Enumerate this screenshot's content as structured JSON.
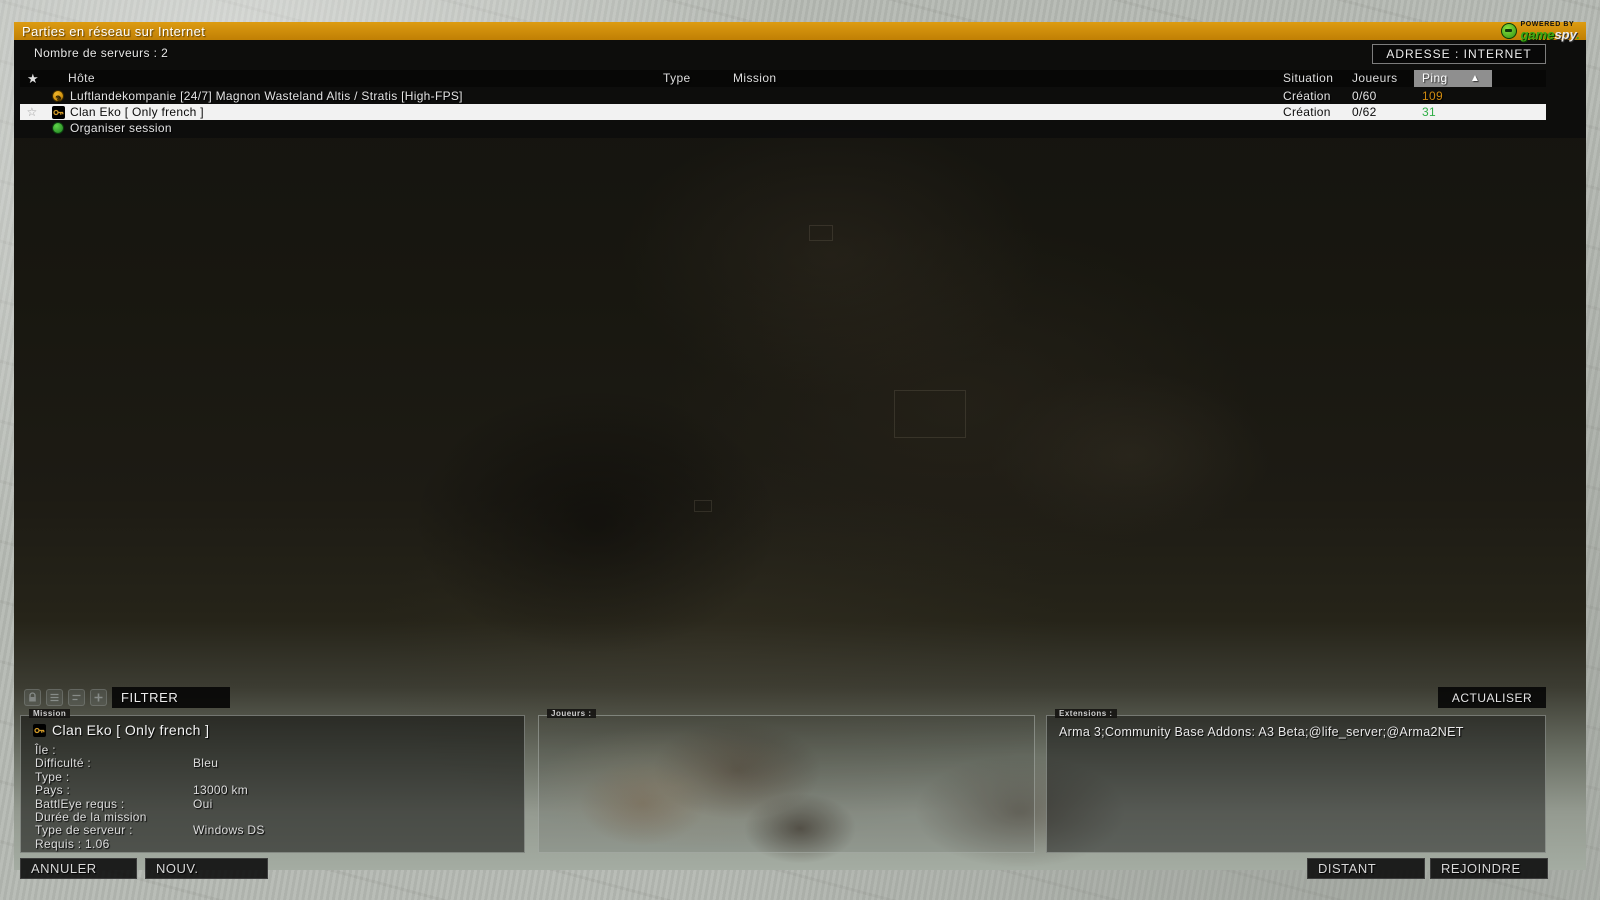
{
  "title_bar": {
    "title": "Parties en réseau sur Internet",
    "powered_by": "POWERED BY",
    "brand_game": "game",
    "brand_spy": "spy",
    "brand_dot": "."
  },
  "toolbar": {
    "server_count": "Nombre de serveurs : 2",
    "address_button": "ADRESSE : INTERNET"
  },
  "icons": {
    "favorite_filled": "★",
    "favorite_outline": "☆",
    "sort_asc": "▲",
    "question_glyph": "?"
  },
  "table": {
    "headers": {
      "host": "Hôte",
      "type": "Type",
      "mission": "Mission",
      "situation": "Situation",
      "players": "Joueurs",
      "ping": "Ping"
    },
    "rows": [
      {
        "icon": "question",
        "favorite": false,
        "host": "Luftlandekompanie [24/7] Magnon Wasteland Altis / Stratis [High-FPS]",
        "situation": "Création",
        "players": "0/60",
        "ping": "109",
        "ping_color": "#cf8a10",
        "selected": false
      },
      {
        "icon": "key",
        "favorite": true,
        "host": "Clan Eko [ Only french ]",
        "situation": "Création",
        "players": "0/62",
        "ping": "31",
        "ping_color": "#2fae45",
        "selected": true
      },
      {
        "icon": "session",
        "favorite": false,
        "host": "Organiser session",
        "situation": "",
        "players": "",
        "ping": "",
        "ping_color": "",
        "selected": false
      }
    ]
  },
  "filter_bar": {
    "filter_button": "FILTRER",
    "refresh_button": "ACTUALISER",
    "icon_names": [
      "lock-icon",
      "list-icon",
      "rules-icon",
      "plus-icon"
    ]
  },
  "mission_panel": {
    "legend": "Mission",
    "title": "Clan Eko [ Only french ]",
    "fields": [
      {
        "label": "Île :",
        "value": ""
      },
      {
        "label": "Difficulté :",
        "value": "Bleu"
      },
      {
        "label": "Type :",
        "value": ""
      },
      {
        "label": "Pays :",
        "value": "13000 km"
      },
      {
        "label": "BattlEye requs :",
        "value": "Oui"
      },
      {
        "label": "Durée de la mission",
        "value": ""
      },
      {
        "label": "Type de serveur :",
        "value": "Windows DS"
      },
      {
        "label": "Requis : 1.06",
        "value": ""
      }
    ]
  },
  "players_panel": {
    "legend": "Joueurs :"
  },
  "extensions_panel": {
    "legend": "Extensions :",
    "content": "Arma 3;Community Base Addons: A3 Beta;@life_server;@Arma2NET"
  },
  "footer": {
    "cancel": "ANNULER",
    "new": "NOUV.",
    "remote": "DISTANT",
    "join": "REJOINDRE"
  },
  "colors": {
    "accent_orange": "#cf8a0a",
    "ping_high": "#cf8a10",
    "ping_low": "#2fae45",
    "selected_row_bg": "#f2f2f2",
    "gamespy_green": "#3aa914",
    "title_bar_bg": "#c98706"
  }
}
